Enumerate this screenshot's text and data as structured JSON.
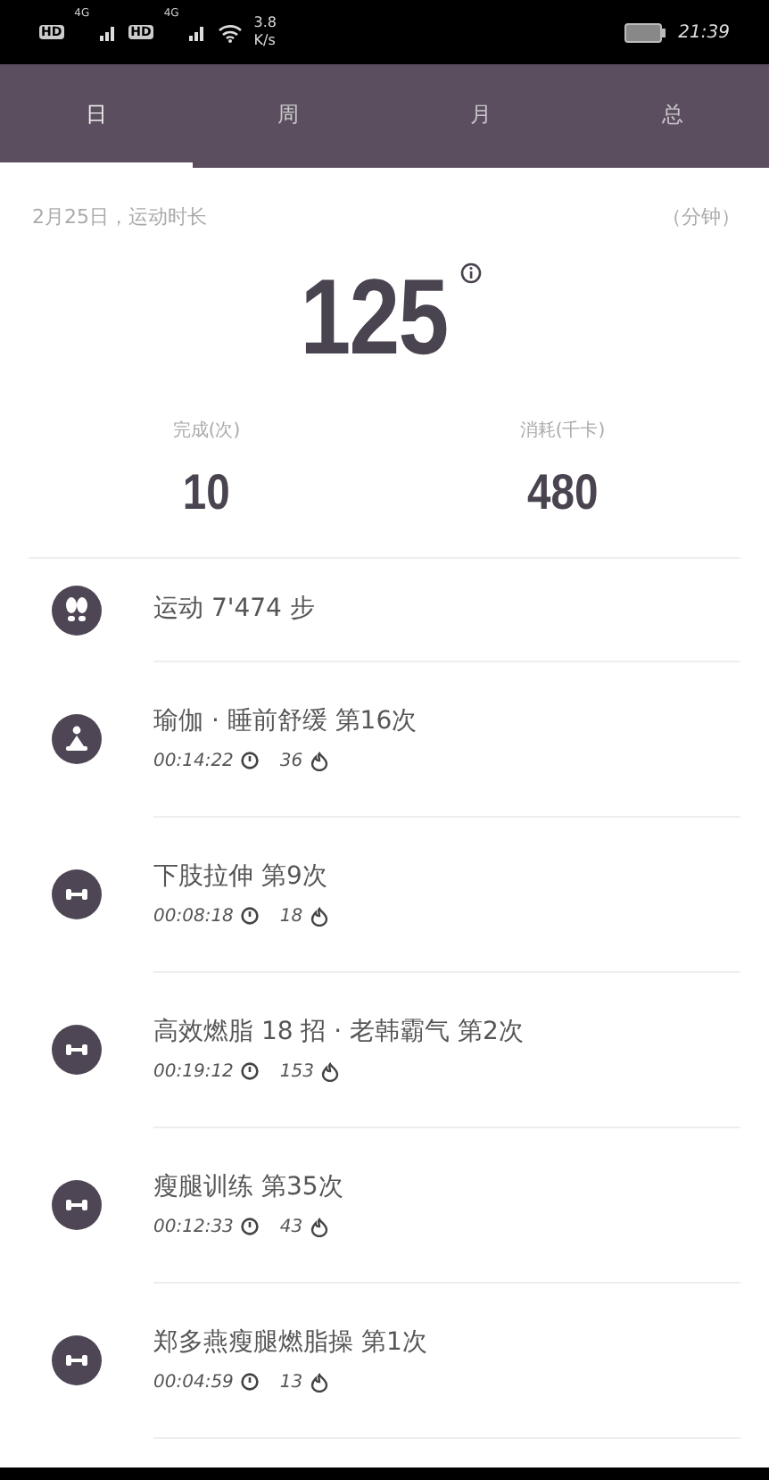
{
  "status_bar": {
    "sims": [
      {
        "badge": "HD",
        "network": "4G"
      },
      {
        "badge": "HD",
        "network": "4G"
      }
    ],
    "speed_value": "3.8",
    "speed_unit": "K/s",
    "time": "21:39"
  },
  "tabs": [
    {
      "label": "日",
      "selected": true
    },
    {
      "label": "周",
      "selected": false
    },
    {
      "label": "月",
      "selected": false
    },
    {
      "label": "总",
      "selected": false
    }
  ],
  "summary": {
    "caption": "2月25日，运动时长",
    "unit": "（分钟）",
    "total": "125"
  },
  "stats": [
    {
      "label": "完成(次)",
      "value": "10"
    },
    {
      "label": "消耗(千卡)",
      "value": "480"
    }
  ],
  "activities": [
    {
      "kind": "steps",
      "title": "运动 7'474 步"
    },
    {
      "kind": "yoga",
      "title": "瑜伽 · 睡前舒缓 第16次",
      "duration": "00:14:22",
      "calories": "36"
    },
    {
      "kind": "strength",
      "title": "下肢拉伸 第9次",
      "duration": "00:08:18",
      "calories": "18"
    },
    {
      "kind": "strength",
      "title": "高效燃脂 18 招 · 老韩霸气 第2次",
      "duration": "00:19:12",
      "calories": "153"
    },
    {
      "kind": "strength",
      "title": "瘦腿训练 第35次",
      "duration": "00:12:33",
      "calories": "43"
    },
    {
      "kind": "strength",
      "title": "郑多燕瘦腿燃脂操 第1次",
      "duration": "00:04:59",
      "calories": "13"
    }
  ]
}
